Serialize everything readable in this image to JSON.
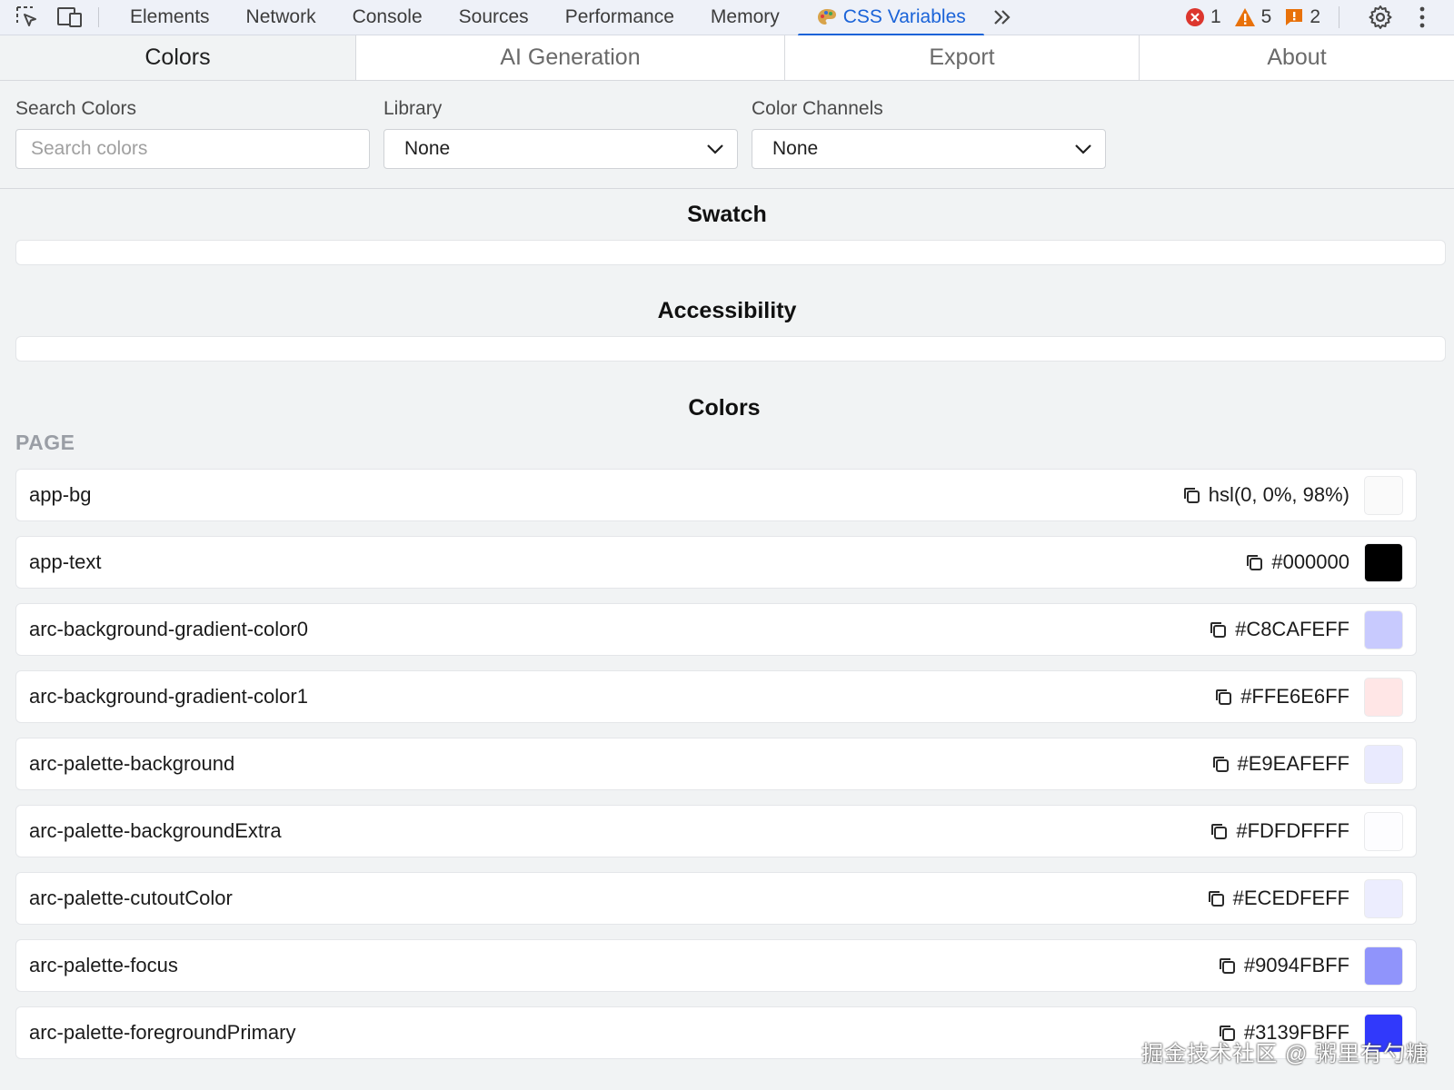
{
  "devtools": {
    "tabs": [
      {
        "label": "Elements"
      },
      {
        "label": "Network"
      },
      {
        "label": "Console"
      },
      {
        "label": "Sources"
      },
      {
        "label": "Performance"
      },
      {
        "label": "Memory"
      },
      {
        "label": "CSS Variables"
      }
    ],
    "active_tab": "CSS Variables",
    "status": {
      "errors": "1",
      "warnings": "5",
      "issues": "2"
    },
    "accent_color": "#1a63d8"
  },
  "ext_tabs": [
    {
      "label": "Colors"
    },
    {
      "label": "AI Generation"
    },
    {
      "label": "Export"
    },
    {
      "label": "About"
    }
  ],
  "filters": {
    "search_label": "Search Colors",
    "search_placeholder": "Search colors",
    "library_label": "Library",
    "library_value": "None",
    "channels_label": "Color Channels",
    "channels_value": "None"
  },
  "sections": {
    "swatch": "Swatch",
    "accessibility": "Accessibility",
    "colors": "Colors"
  },
  "group": "PAGE",
  "colors": [
    {
      "name": "app-bg",
      "value": "hsl(0, 0%, 98%)",
      "swatch": "#fafafa"
    },
    {
      "name": "app-text",
      "value": "#000000",
      "swatch": "#000000"
    },
    {
      "name": "arc-background-gradient-color0",
      "value": "#C8CAFEFF",
      "swatch": "#C8CAFE"
    },
    {
      "name": "arc-background-gradient-color1",
      "value": "#FFE6E6FF",
      "swatch": "#FFE6E6"
    },
    {
      "name": "arc-palette-background",
      "value": "#E9EAFEFF",
      "swatch": "#E9EAFE"
    },
    {
      "name": "arc-palette-backgroundExtra",
      "value": "#FDFDFFFF",
      "swatch": "#FDFDFF"
    },
    {
      "name": "arc-palette-cutoutColor",
      "value": "#ECEDFEFF",
      "swatch": "#ECEDFE"
    },
    {
      "name": "arc-palette-focus",
      "value": "#9094FBFF",
      "swatch": "#9094FB"
    },
    {
      "name": "arc-palette-foregroundPrimary",
      "value": "#3139FBFF",
      "swatch": "#3139FB"
    }
  ],
  "watermark": "掘金技术社区 @ 粥里有勺糖"
}
